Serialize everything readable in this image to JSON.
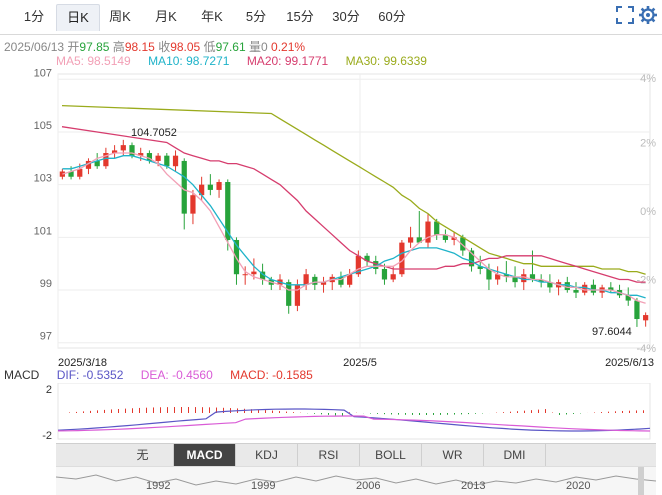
{
  "tabs": [
    {
      "label": "1分",
      "active": false
    },
    {
      "label": "日K",
      "active": true
    },
    {
      "label": "周K",
      "active": false
    },
    {
      "label": "月K",
      "active": false
    },
    {
      "label": "年K",
      "active": false
    },
    {
      "label": "5分",
      "active": false
    },
    {
      "label": "15分",
      "active": false
    },
    {
      "label": "30分",
      "active": false
    },
    {
      "label": "60分",
      "active": false
    }
  ],
  "info": {
    "date": "2025/06/13",
    "open_label": "开",
    "open": "97.85",
    "high_label": "高",
    "high": "98.15",
    "close_label": "收",
    "close": "98.05",
    "low_label": "低",
    "low": "97.61",
    "vol_label": "量",
    "vol": "0",
    "change": "0.21%"
  },
  "ma": {
    "ma5": "MA5: 98.5149",
    "ma10": "MA10: 98.7271",
    "ma20": "MA20: 99.1771",
    "ma30": "MA30: 99.6339"
  },
  "colors": {
    "up": "#e3382d",
    "down": "#27a33b",
    "ma5": "#f2a0b6",
    "ma10": "#1fb3c9",
    "ma20": "#d63d6e",
    "ma30": "#9aab1c",
    "dif": "#5a56c6",
    "dea": "#d95bd6"
  },
  "macd": {
    "label": "MACD",
    "dif": "DIF: -0.5352",
    "dea": "DEA: -0.4560",
    "macd": "MACD: -0.1585"
  },
  "indicator_tabs": [
    "无",
    "MACD",
    "KDJ",
    "RSI",
    "BOLL",
    "WR",
    "DMI"
  ],
  "nav_years": [
    "1992",
    "1999",
    "2006",
    "2013",
    "2020"
  ],
  "chart_data": {
    "type": "candlestick",
    "y_ticks": [
      107,
      105,
      103,
      101,
      99,
      97
    ],
    "y_range": [
      96.8,
      107.2
    ],
    "pct_ticks": [
      "4%",
      "2%",
      "0%",
      "-2%",
      "-4%"
    ],
    "x_labels": [
      "2025/3/18",
      "2025/5",
      "2025/6/13"
    ],
    "annotations": {
      "max": "104.7052",
      "min": "97.6044"
    },
    "macd_ticks": [
      "2",
      "-2"
    ],
    "candles": [
      [
        103.3,
        103.6,
        103.2,
        103.5
      ],
      [
        103.5,
        103.7,
        103.2,
        103.3
      ],
      [
        103.3,
        103.8,
        103.2,
        103.6
      ],
      [
        103.6,
        104.0,
        103.4,
        103.9
      ],
      [
        103.9,
        104.2,
        103.6,
        103.7
      ],
      [
        103.7,
        104.4,
        103.6,
        104.2
      ],
      [
        104.2,
        104.5,
        104.0,
        104.3
      ],
      [
        104.3,
        104.7,
        104.1,
        104.5
      ],
      [
        104.5,
        104.6,
        104.0,
        104.1
      ],
      [
        104.1,
        104.4,
        103.9,
        104.2
      ],
      [
        104.2,
        104.3,
        103.8,
        103.9
      ],
      [
        103.9,
        104.2,
        103.7,
        104.1
      ],
      [
        104.1,
        104.2,
        103.6,
        103.7
      ],
      [
        103.7,
        104.3,
        103.5,
        104.1
      ],
      [
        103.9,
        104.0,
        101.3,
        101.9
      ],
      [
        101.9,
        102.8,
        101.5,
        102.6
      ],
      [
        102.6,
        103.3,
        102.4,
        103.0
      ],
      [
        103.0,
        103.4,
        102.6,
        102.8
      ],
      [
        102.8,
        103.2,
        102.5,
        103.1
      ],
      [
        103.1,
        103.2,
        100.5,
        100.9
      ],
      [
        100.9,
        101.0,
        99.2,
        99.6
      ],
      [
        99.6,
        99.9,
        99.2,
        99.6
      ],
      [
        99.6,
        100.2,
        99.4,
        99.7
      ],
      [
        99.7,
        100.0,
        99.2,
        99.4
      ],
      [
        99.4,
        99.5,
        99.0,
        99.2
      ],
      [
        99.2,
        99.6,
        99.0,
        99.4
      ],
      [
        99.3,
        99.4,
        98.1,
        98.4
      ],
      [
        98.4,
        99.4,
        98.2,
        99.2
      ],
      [
        99.2,
        99.8,
        99.0,
        99.6
      ],
      [
        99.5,
        99.6,
        99.0,
        99.2
      ],
      [
        99.2,
        99.5,
        98.9,
        99.3
      ],
      [
        99.3,
        99.6,
        99.0,
        99.5
      ],
      [
        99.5,
        99.7,
        99.1,
        99.2
      ],
      [
        99.2,
        99.8,
        99.1,
        99.6
      ],
      [
        99.6,
        100.5,
        99.5,
        100.3
      ],
      [
        100.3,
        100.4,
        99.9,
        100.1
      ],
      [
        100.1,
        100.3,
        99.6,
        99.8
      ],
      [
        99.8,
        100.0,
        99.2,
        99.4
      ],
      [
        99.4,
        99.9,
        99.3,
        99.6
      ],
      [
        99.6,
        100.9,
        99.5,
        100.8
      ],
      [
        100.8,
        101.4,
        100.6,
        101.0
      ],
      [
        101.0,
        102.0,
        100.8,
        100.8
      ],
      [
        100.8,
        101.9,
        100.6,
        101.6
      ],
      [
        101.6,
        101.7,
        100.9,
        101.1
      ],
      [
        101.1,
        101.3,
        100.8,
        100.9
      ],
      [
        100.9,
        101.2,
        100.7,
        101.0
      ],
      [
        101.0,
        101.1,
        100.3,
        100.5
      ],
      [
        100.5,
        100.6,
        99.7,
        99.9
      ],
      [
        99.9,
        100.3,
        99.6,
        99.8
      ],
      [
        99.8,
        100.0,
        99.0,
        99.4
      ],
      [
        99.4,
        99.9,
        99.2,
        99.6
      ],
      [
        99.6,
        100.1,
        99.3,
        99.5
      ],
      [
        99.5,
        99.9,
        99.1,
        99.3
      ],
      [
        99.3,
        99.8,
        99.0,
        99.6
      ],
      [
        99.6,
        100.5,
        99.3,
        99.4
      ],
      [
        99.4,
        99.6,
        99.1,
        99.3
      ],
      [
        99.3,
        99.6,
        98.9,
        99.1
      ],
      [
        99.1,
        99.4,
        98.8,
        99.3
      ],
      [
        99.3,
        99.5,
        98.9,
        99.0
      ],
      [
        99.0,
        99.3,
        98.7,
        98.9
      ],
      [
        98.9,
        99.3,
        98.8,
        99.2
      ],
      [
        99.2,
        99.4,
        98.8,
        98.9
      ],
      [
        98.9,
        99.2,
        98.7,
        99.1
      ],
      [
        99.1,
        99.3,
        98.9,
        99.0
      ],
      [
        99.0,
        99.2,
        98.7,
        98.8
      ],
      [
        98.8,
        99.1,
        98.4,
        98.6
      ],
      [
        98.6,
        98.7,
        97.6,
        97.9
      ],
      [
        97.85,
        98.15,
        97.61,
        98.05
      ]
    ],
    "ma5": [
      103.4,
      103.5,
      103.6,
      103.8,
      104.0,
      104.1,
      104.2,
      104.2,
      104.2,
      104.1,
      104.0,
      103.8,
      103.4,
      103.1,
      102.8,
      102.7,
      102.4,
      102.0,
      101.4,
      100.8,
      100.2,
      99.7,
      99.5,
      99.4,
      99.3,
      99.2,
      99.0,
      99.0,
      99.2,
      99.3,
      99.3,
      99.4,
      99.4,
      99.6,
      99.8,
      99.9,
      99.9,
      99.9,
      99.9,
      100.1,
      100.5,
      100.8,
      101.0,
      101.1,
      101.1,
      101.0,
      100.7,
      100.4,
      100.1,
      99.8,
      99.6,
      99.5,
      99.5,
      99.5,
      99.4,
      99.4,
      99.3,
      99.2,
      99.1,
      99.1,
      99.0,
      99.0,
      99.0,
      99.0,
      98.9,
      98.8,
      98.6,
      98.5
    ],
    "ma10": [
      103.6,
      103.6,
      103.7,
      103.8,
      103.9,
      104.0,
      104.0,
      104.1,
      104.1,
      104.0,
      103.9,
      103.8,
      103.7,
      103.5,
      103.3,
      103.0,
      102.6,
      102.2,
      101.7,
      101.2,
      100.7,
      100.3,
      99.9,
      99.6,
      99.4,
      99.3,
      99.2,
      99.2,
      99.2,
      99.3,
      99.3,
      99.4,
      99.5,
      99.6,
      99.7,
      99.8,
      99.9,
      100.1,
      100.2,
      100.4,
      100.5,
      100.6,
      100.6,
      100.6,
      100.5,
      100.4,
      100.2,
      100.1,
      99.9,
      99.8,
      99.7,
      99.6,
      99.5,
      99.4,
      99.4,
      99.3,
      99.3,
      99.2,
      99.2,
      99.1,
      99.1,
      99.0,
      99.0,
      98.9,
      98.9,
      98.8,
      98.8,
      98.7
    ],
    "ma20": [
      104.6,
      104.4,
      104.2,
      104.1,
      104.0,
      103.9,
      103.9,
      103.8,
      103.8,
      103.7,
      103.6,
      103.4,
      103.2,
      103.0,
      102.7,
      102.4,
      102.0,
      101.7,
      101.4,
      101.1,
      100.8,
      100.5,
      100.3,
      100.1,
      100.0,
      99.9,
      99.8,
      99.8,
      99.8,
      99.8,
      99.8,
      99.8,
      99.9,
      99.9,
      100.0,
      100.0,
      100.1,
      100.2,
      100.2,
      100.3,
      100.3,
      100.3,
      100.3,
      100.3,
      100.2,
      100.1,
      100.0,
      99.9,
      99.8,
      99.7,
      99.6,
      99.5,
      99.4,
      99.4,
      99.3,
      99.3
    ],
    "ma30": [
      105.7,
      105.5,
      105.3,
      105.1,
      104.9,
      104.7,
      104.5,
      104.3,
      104.1,
      103.9,
      103.7,
      103.5,
      103.3,
      103.1,
      102.9,
      102.6,
      102.4,
      102.1,
      101.9,
      101.6,
      101.4,
      101.2,
      101.0,
      100.8,
      100.6,
      100.4,
      100.3,
      100.2,
      100.1,
      100.0,
      100.0,
      99.9,
      99.9,
      99.9,
      99.9,
      99.9,
      99.9,
      99.9,
      99.8,
      99.8,
      99.8,
      99.7,
      99.7,
      99.6
    ]
  }
}
